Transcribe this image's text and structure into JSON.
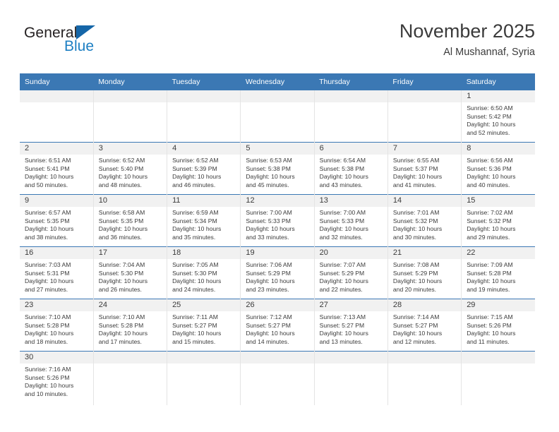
{
  "brand": {
    "name_top": "General",
    "name_bottom": "Blue",
    "accent_color": "#1d7fc3",
    "triangle_color": "#1566a8"
  },
  "header": {
    "title": "November 2025",
    "subtitle": "Al Mushannaf, Syria"
  },
  "theme": {
    "header_row_bg": "#3b78b4",
    "daynum_band_bg": "#f1f1f1",
    "row_divider": "#3b78b4",
    "cell_divider": "#e4e4e4",
    "text_color": "#3b3b3b"
  },
  "weekday_headers": [
    "Sunday",
    "Monday",
    "Tuesday",
    "Wednesday",
    "Thursday",
    "Friday",
    "Saturday"
  ],
  "weeks": [
    [
      {
        "day": "",
        "sunrise": "",
        "sunset": "",
        "daylight_line1": "",
        "daylight_line2": ""
      },
      {
        "day": "",
        "sunrise": "",
        "sunset": "",
        "daylight_line1": "",
        "daylight_line2": ""
      },
      {
        "day": "",
        "sunrise": "",
        "sunset": "",
        "daylight_line1": "",
        "daylight_line2": ""
      },
      {
        "day": "",
        "sunrise": "",
        "sunset": "",
        "daylight_line1": "",
        "daylight_line2": ""
      },
      {
        "day": "",
        "sunrise": "",
        "sunset": "",
        "daylight_line1": "",
        "daylight_line2": ""
      },
      {
        "day": "",
        "sunrise": "",
        "sunset": "",
        "daylight_line1": "",
        "daylight_line2": ""
      },
      {
        "day": "1",
        "sunrise": "Sunrise: 6:50 AM",
        "sunset": "Sunset: 5:42 PM",
        "daylight_line1": "Daylight: 10 hours",
        "daylight_line2": "and 52 minutes."
      }
    ],
    [
      {
        "day": "2",
        "sunrise": "Sunrise: 6:51 AM",
        "sunset": "Sunset: 5:41 PM",
        "daylight_line1": "Daylight: 10 hours",
        "daylight_line2": "and 50 minutes."
      },
      {
        "day": "3",
        "sunrise": "Sunrise: 6:52 AM",
        "sunset": "Sunset: 5:40 PM",
        "daylight_line1": "Daylight: 10 hours",
        "daylight_line2": "and 48 minutes."
      },
      {
        "day": "4",
        "sunrise": "Sunrise: 6:52 AM",
        "sunset": "Sunset: 5:39 PM",
        "daylight_line1": "Daylight: 10 hours",
        "daylight_line2": "and 46 minutes."
      },
      {
        "day": "5",
        "sunrise": "Sunrise: 6:53 AM",
        "sunset": "Sunset: 5:38 PM",
        "daylight_line1": "Daylight: 10 hours",
        "daylight_line2": "and 45 minutes."
      },
      {
        "day": "6",
        "sunrise": "Sunrise: 6:54 AM",
        "sunset": "Sunset: 5:38 PM",
        "daylight_line1": "Daylight: 10 hours",
        "daylight_line2": "and 43 minutes."
      },
      {
        "day": "7",
        "sunrise": "Sunrise: 6:55 AM",
        "sunset": "Sunset: 5:37 PM",
        "daylight_line1": "Daylight: 10 hours",
        "daylight_line2": "and 41 minutes."
      },
      {
        "day": "8",
        "sunrise": "Sunrise: 6:56 AM",
        "sunset": "Sunset: 5:36 PM",
        "daylight_line1": "Daylight: 10 hours",
        "daylight_line2": "and 40 minutes."
      }
    ],
    [
      {
        "day": "9",
        "sunrise": "Sunrise: 6:57 AM",
        "sunset": "Sunset: 5:35 PM",
        "daylight_line1": "Daylight: 10 hours",
        "daylight_line2": "and 38 minutes."
      },
      {
        "day": "10",
        "sunrise": "Sunrise: 6:58 AM",
        "sunset": "Sunset: 5:35 PM",
        "daylight_line1": "Daylight: 10 hours",
        "daylight_line2": "and 36 minutes."
      },
      {
        "day": "11",
        "sunrise": "Sunrise: 6:59 AM",
        "sunset": "Sunset: 5:34 PM",
        "daylight_line1": "Daylight: 10 hours",
        "daylight_line2": "and 35 minutes."
      },
      {
        "day": "12",
        "sunrise": "Sunrise: 7:00 AM",
        "sunset": "Sunset: 5:33 PM",
        "daylight_line1": "Daylight: 10 hours",
        "daylight_line2": "and 33 minutes."
      },
      {
        "day": "13",
        "sunrise": "Sunrise: 7:00 AM",
        "sunset": "Sunset: 5:33 PM",
        "daylight_line1": "Daylight: 10 hours",
        "daylight_line2": "and 32 minutes."
      },
      {
        "day": "14",
        "sunrise": "Sunrise: 7:01 AM",
        "sunset": "Sunset: 5:32 PM",
        "daylight_line1": "Daylight: 10 hours",
        "daylight_line2": "and 30 minutes."
      },
      {
        "day": "15",
        "sunrise": "Sunrise: 7:02 AM",
        "sunset": "Sunset: 5:32 PM",
        "daylight_line1": "Daylight: 10 hours",
        "daylight_line2": "and 29 minutes."
      }
    ],
    [
      {
        "day": "16",
        "sunrise": "Sunrise: 7:03 AM",
        "sunset": "Sunset: 5:31 PM",
        "daylight_line1": "Daylight: 10 hours",
        "daylight_line2": "and 27 minutes."
      },
      {
        "day": "17",
        "sunrise": "Sunrise: 7:04 AM",
        "sunset": "Sunset: 5:30 PM",
        "daylight_line1": "Daylight: 10 hours",
        "daylight_line2": "and 26 minutes."
      },
      {
        "day": "18",
        "sunrise": "Sunrise: 7:05 AM",
        "sunset": "Sunset: 5:30 PM",
        "daylight_line1": "Daylight: 10 hours",
        "daylight_line2": "and 24 minutes."
      },
      {
        "day": "19",
        "sunrise": "Sunrise: 7:06 AM",
        "sunset": "Sunset: 5:29 PM",
        "daylight_line1": "Daylight: 10 hours",
        "daylight_line2": "and 23 minutes."
      },
      {
        "day": "20",
        "sunrise": "Sunrise: 7:07 AM",
        "sunset": "Sunset: 5:29 PM",
        "daylight_line1": "Daylight: 10 hours",
        "daylight_line2": "and 22 minutes."
      },
      {
        "day": "21",
        "sunrise": "Sunrise: 7:08 AM",
        "sunset": "Sunset: 5:29 PM",
        "daylight_line1": "Daylight: 10 hours",
        "daylight_line2": "and 20 minutes."
      },
      {
        "day": "22",
        "sunrise": "Sunrise: 7:09 AM",
        "sunset": "Sunset: 5:28 PM",
        "daylight_line1": "Daylight: 10 hours",
        "daylight_line2": "and 19 minutes."
      }
    ],
    [
      {
        "day": "23",
        "sunrise": "Sunrise: 7:10 AM",
        "sunset": "Sunset: 5:28 PM",
        "daylight_line1": "Daylight: 10 hours",
        "daylight_line2": "and 18 minutes."
      },
      {
        "day": "24",
        "sunrise": "Sunrise: 7:10 AM",
        "sunset": "Sunset: 5:28 PM",
        "daylight_line1": "Daylight: 10 hours",
        "daylight_line2": "and 17 minutes."
      },
      {
        "day": "25",
        "sunrise": "Sunrise: 7:11 AM",
        "sunset": "Sunset: 5:27 PM",
        "daylight_line1": "Daylight: 10 hours",
        "daylight_line2": "and 15 minutes."
      },
      {
        "day": "26",
        "sunrise": "Sunrise: 7:12 AM",
        "sunset": "Sunset: 5:27 PM",
        "daylight_line1": "Daylight: 10 hours",
        "daylight_line2": "and 14 minutes."
      },
      {
        "day": "27",
        "sunrise": "Sunrise: 7:13 AM",
        "sunset": "Sunset: 5:27 PM",
        "daylight_line1": "Daylight: 10 hours",
        "daylight_line2": "and 13 minutes."
      },
      {
        "day": "28",
        "sunrise": "Sunrise: 7:14 AM",
        "sunset": "Sunset: 5:27 PM",
        "daylight_line1": "Daylight: 10 hours",
        "daylight_line2": "and 12 minutes."
      },
      {
        "day": "29",
        "sunrise": "Sunrise: 7:15 AM",
        "sunset": "Sunset: 5:26 PM",
        "daylight_line1": "Daylight: 10 hours",
        "daylight_line2": "and 11 minutes."
      }
    ],
    [
      {
        "day": "30",
        "sunrise": "Sunrise: 7:16 AM",
        "sunset": "Sunset: 5:26 PM",
        "daylight_line1": "Daylight: 10 hours",
        "daylight_line2": "and 10 minutes."
      },
      {
        "day": "",
        "sunrise": "",
        "sunset": "",
        "daylight_line1": "",
        "daylight_line2": ""
      },
      {
        "day": "",
        "sunrise": "",
        "sunset": "",
        "daylight_line1": "",
        "daylight_line2": ""
      },
      {
        "day": "",
        "sunrise": "",
        "sunset": "",
        "daylight_line1": "",
        "daylight_line2": ""
      },
      {
        "day": "",
        "sunrise": "",
        "sunset": "",
        "daylight_line1": "",
        "daylight_line2": ""
      },
      {
        "day": "",
        "sunrise": "",
        "sunset": "",
        "daylight_line1": "",
        "daylight_line2": ""
      },
      {
        "day": "",
        "sunrise": "",
        "sunset": "",
        "daylight_line1": "",
        "daylight_line2": ""
      }
    ]
  ]
}
